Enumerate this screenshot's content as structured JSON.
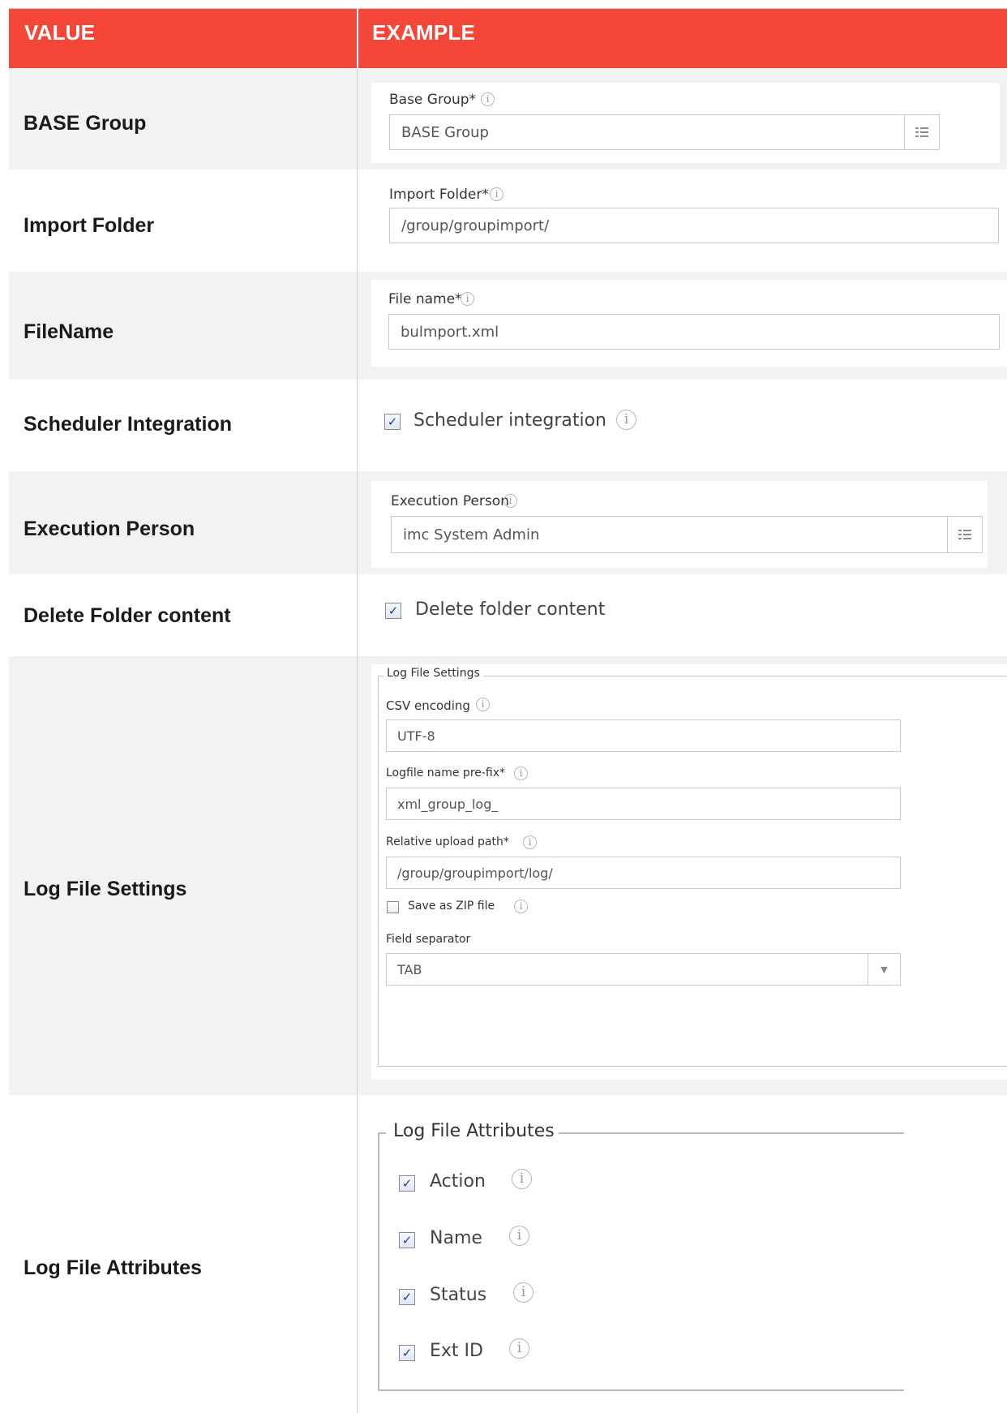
{
  "header": {
    "value_col": "VALUE",
    "example_col": "EXAMPLE"
  },
  "rows": [
    {
      "label": "BASE Group"
    },
    {
      "label": "Import Folder"
    },
    {
      "label": "FileName"
    },
    {
      "label": "Scheduler Integration"
    },
    {
      "label": "Execution Person"
    },
    {
      "label": "Delete Folder content"
    },
    {
      "label": "Log File Settings"
    },
    {
      "label": "Log File Attributes"
    }
  ],
  "base_group": {
    "field_label": "Base Group*",
    "value": "BASE Group"
  },
  "import_folder": {
    "field_label": "Import Folder*",
    "value": "/group/groupimport/"
  },
  "file_name": {
    "field_label": "File name*",
    "value": "bulmport.xml"
  },
  "scheduler": {
    "label": "Scheduler integration",
    "checked": true
  },
  "execution_person": {
    "field_label": "Execution Person",
    "value": "imc System Admin"
  },
  "delete_folder": {
    "label": "Delete folder content",
    "checked": true
  },
  "log_settings": {
    "legend": "Log File Settings",
    "csv_encoding": {
      "label": "CSV encoding",
      "value": "UTF-8"
    },
    "prefix": {
      "label": "Logfile name pre-fix*",
      "value": "xml_group_log_"
    },
    "upload_path": {
      "label": "Relative upload path*",
      "value": "/group/groupimport/log/"
    },
    "save_zip": {
      "label": "Save as ZIP file",
      "checked": false
    },
    "field_separator": {
      "label": "Field separator",
      "value": "TAB"
    }
  },
  "log_attributes": {
    "legend": "Log File Attributes",
    "items": [
      {
        "label": "Action",
        "checked": true
      },
      {
        "label": "Name",
        "checked": true
      },
      {
        "label": "Status",
        "checked": true
      },
      {
        "label": "Ext ID",
        "checked": true
      }
    ]
  },
  "icons": {
    "info": "info-icon",
    "picker": "list-picker-icon",
    "dropdown": "chevron-down-icon",
    "checkmark": "check-icon"
  },
  "colors": {
    "header_bg": "#f4473a",
    "row_gray": "#f2f2f2",
    "check_mark": "#223f8f"
  }
}
